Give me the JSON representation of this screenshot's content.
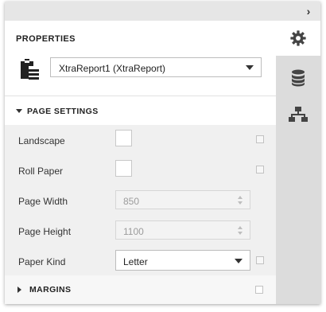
{
  "panel": {
    "title": "PROPERTIES",
    "report_selector": {
      "value": "XtraReport1 (XtraReport)"
    }
  },
  "tabs": [
    {
      "icon": "gear-icon",
      "name": "properties",
      "active": true
    },
    {
      "icon": "database-icon",
      "name": "field-list",
      "active": false
    },
    {
      "icon": "hierarchy-icon",
      "name": "report-explorer",
      "active": false
    }
  ],
  "page_settings": {
    "label": "PAGE SETTINGS",
    "expanded": true,
    "rows": [
      {
        "label": "Landscape",
        "type": "checkbox",
        "checked": false
      },
      {
        "label": "Roll Paper",
        "type": "checkbox",
        "checked": false
      },
      {
        "label": "Page Width",
        "type": "spin",
        "value": "850",
        "disabled": true
      },
      {
        "label": "Page Height",
        "type": "spin",
        "value": "1100",
        "disabled": true
      },
      {
        "label": "Paper Kind",
        "type": "select",
        "value": "Letter"
      }
    ]
  },
  "margins": {
    "label": "MARGINS",
    "expanded": false
  },
  "colors": {
    "topbar": "#e6e6e6",
    "tab_strip": "#dcdcdc",
    "group_body": "#f0f0f0",
    "icon": "#444444"
  }
}
